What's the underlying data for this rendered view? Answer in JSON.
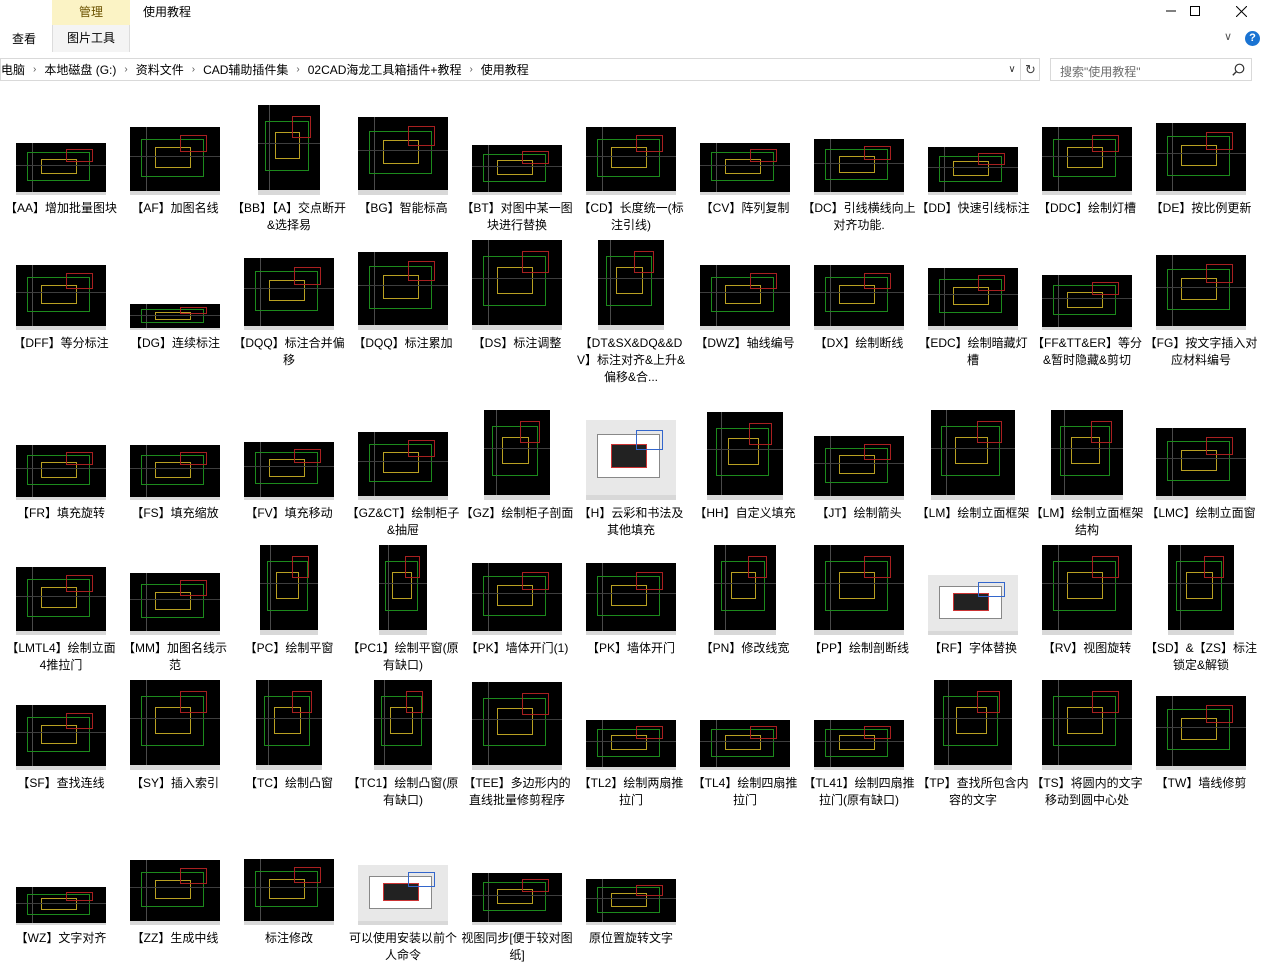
{
  "window": {
    "title": "使用教程",
    "contextual_tab": "管理",
    "contextual_subtab": "图片工具",
    "ribbon_tabs": [
      "查看"
    ],
    "help_label": "?"
  },
  "address": {
    "crumbs": [
      "电脑",
      "本地磁盘 (G:)",
      "资料文件",
      "CAD辅助插件集",
      "02CAD海龙工具箱插件+教程",
      "使用教程"
    ]
  },
  "search": {
    "placeholder": "搜索\"使用教程\""
  },
  "files": [
    {
      "label": "【AA】增加批量图块"
    },
    {
      "label": "【AF】加图名线"
    },
    {
      "label": "【BB】【A】交点断开&选择易"
    },
    {
      "label": "【BG】智能标高"
    },
    {
      "label": "【BT】对图中某一图块进行替换"
    },
    {
      "label": "【CD】长度统一(标注引线)"
    },
    {
      "label": "【CV】阵列复制"
    },
    {
      "label": "【DC】引线横线向上对齐功能."
    },
    {
      "label": "【DD】快速引线标注"
    },
    {
      "label": "【DDC】绘制灯槽"
    },
    {
      "label": "【DE】按比例更新"
    },
    {
      "label": "【DFF】等分标注"
    },
    {
      "label": "【DG】连续标注"
    },
    {
      "label": "【DQQ】标注合并偏移"
    },
    {
      "label": "【DQQ】标注累加"
    },
    {
      "label": "【DS】标注调整"
    },
    {
      "label": "【DT&SX&DQ&&DV】标注对齐&上升&偏移&合..."
    },
    {
      "label": "【DWZ】轴线编号"
    },
    {
      "label": "【DX】绘制断线"
    },
    {
      "label": "【EDC】绘制暗藏灯槽"
    },
    {
      "label": "【FF&TT&ER】等分&暂时隐藏&剪切"
    },
    {
      "label": "【FG】按文字插入对应材料编号"
    },
    {
      "label": "【FR】填充旋转"
    },
    {
      "label": "【FS】填充缩放"
    },
    {
      "label": "【FV】填充移动"
    },
    {
      "label": "【GZ&CT】绘制柜子&抽屉"
    },
    {
      "label": "【GZ】绘制柜子剖面"
    },
    {
      "label": "【H】云彩和书法及其他填充"
    },
    {
      "label": "【HH】自定义填充"
    },
    {
      "label": "【JT】绘制箭头"
    },
    {
      "label": "【LM】绘制立面框架"
    },
    {
      "label": "【LM】绘制立面框架结构"
    },
    {
      "label": "【LMC】绘制立面窗"
    },
    {
      "label": "【LMTL4】绘制立面4推拉门"
    },
    {
      "label": "【MM】加图名线示范"
    },
    {
      "label": "【PC】绘制平窗"
    },
    {
      "label": "【PC1】绘制平窗(原有缺口)"
    },
    {
      "label": "【PK】墙体开门(1)"
    },
    {
      "label": "【PK】墙体开门"
    },
    {
      "label": "【PN】修改线宽"
    },
    {
      "label": "【PP】绘制剖断线"
    },
    {
      "label": "【RF】字体替换"
    },
    {
      "label": "【RV】视图旋转"
    },
    {
      "label": "【SD】&【ZS】标注锁定&解锁"
    },
    {
      "label": "【SF】查找连线"
    },
    {
      "label": "【SY】插入索引"
    },
    {
      "label": "【TC】绘制凸窗"
    },
    {
      "label": "【TC1】绘制凸窗(原有缺口)"
    },
    {
      "label": "【TEE】多边形内的直线批量修剪程序"
    },
    {
      "label": "【TL2】绘制两扇推拉门"
    },
    {
      "label": "【TL4】绘制四扇推拉门"
    },
    {
      "label": "【TL41】绘制四扇推拉门(原有缺口)"
    },
    {
      "label": "【TP】查找所包含内容的文字"
    },
    {
      "label": "【TS】将圆内的文字移动到圆中心处"
    },
    {
      "label": "【TW】墙线修剪"
    },
    {
      "label": "【WZ】文字对齐"
    },
    {
      "label": "【ZZ】生成中线"
    },
    {
      "label": "标注修改"
    },
    {
      "label": "可以使用安装以前个人命令"
    },
    {
      "label": "视图同步[便于较对图纸]"
    },
    {
      "label": "原位置旋转文字"
    }
  ]
}
